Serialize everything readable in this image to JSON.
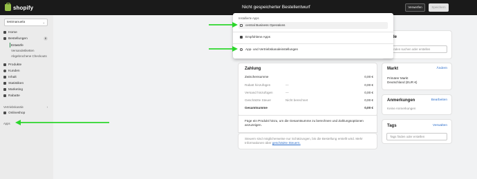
{
  "topbar": {
    "logo_text": "shopify",
    "title": "Nicht gespeicherter Bestellentwurf",
    "discard_label": "Verwerfen",
    "save_label": "Speichern"
  },
  "sidebar": {
    "store_name": "testmanuela",
    "items": [
      {
        "label": "Home"
      },
      {
        "label": "Bestellungen",
        "badge": "8"
      },
      {
        "label": "Entwürfe"
      },
      {
        "label": "Versandetiketten"
      },
      {
        "label": "Abgebrochene Checkouts"
      },
      {
        "label": "Produkte"
      },
      {
        "label": "Kunden"
      },
      {
        "label": "Inhalt"
      },
      {
        "label": "Statistiken"
      },
      {
        "label": "Marketing"
      },
      {
        "label": "Rabatte"
      }
    ],
    "sales_channels_label": "Vertriebskanäle",
    "online_store_label": "Onlineshop",
    "apps_label": "Apps"
  },
  "dropdown": {
    "heading": "Installierte Apps",
    "app_item": "central Business Operations",
    "recommended": "Empfohlene Apps",
    "settings": "App- und Vertriebskanaleinstellungen"
  },
  "payment": {
    "title": "Zahlung",
    "rows": [
      {
        "label": "Zwischensumme",
        "mid": "",
        "value": "0,00 €"
      },
      {
        "label": "Rabatt hinzufügen",
        "mid": "—",
        "value": "0,00 €"
      },
      {
        "label": "Versand hinzufügen",
        "mid": "—",
        "value": "0,00 €"
      },
      {
        "label": "Geschätzte Steuer",
        "mid": "Nicht berechnet",
        "value": "0,00 €"
      },
      {
        "label": "Gesamtsumme",
        "mid": "",
        "value": "0,00 €"
      }
    ],
    "info": "Füge ein Produkt hinzu, um die Gesamtsumme zu berechnen und Zahlungsoptionen anzuzeigen.",
    "tax_note_pre": "Steuern sind möglicherweise nur Schätzungen, bis die Bestellung erstellt wird. Mehr Informationen über",
    "tax_note_link": "geschätzte Steuern."
  },
  "customer": {
    "title_partial": "de",
    "search_placeholder": "Kunden suchen oder erstellen"
  },
  "market": {
    "title": "Markt",
    "change_label": "Ändern",
    "primary": "Primärer Markt",
    "country": "Deutschland (EUR €)"
  },
  "notes": {
    "title": "Anmerkungen",
    "edit_label": "Bearbeiten",
    "empty": "Keine Anmerkungen"
  },
  "tags": {
    "title": "Tags",
    "manage_label": "Verwalten",
    "placeholder": "Tags finden oder erstellen"
  },
  "colors": {
    "arrow": "#2bd62b",
    "link": "#2c6ecb",
    "topbar": "#1a1a1a"
  }
}
